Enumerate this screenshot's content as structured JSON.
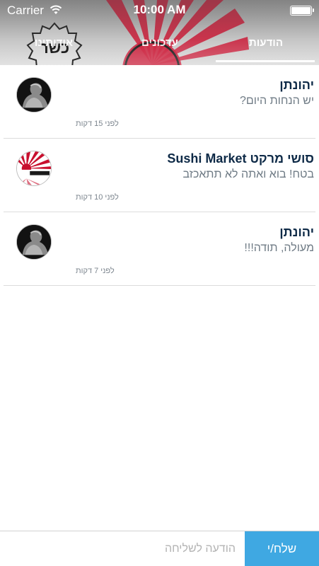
{
  "status_bar": {
    "carrier": "Carrier",
    "time": "10:00 AM"
  },
  "tabs": [
    {
      "label": "הודעות",
      "active": true
    },
    {
      "label": "עדכונים",
      "active": false
    },
    {
      "label": "אודותינו",
      "active": false
    }
  ],
  "header": {
    "badge_text": "כשר",
    "accent_color": "#c8102e"
  },
  "messages": [
    {
      "sender": "יהונתן",
      "preview": "יש הנחות היום?",
      "time": "לפני 15 דקות",
      "avatar": "person-avatar"
    },
    {
      "sender": "סושי מרקט Sushi Market",
      "preview": "בטח! בוא ואתה לא תתאכזב",
      "time": "לפני 10 דקות",
      "avatar": "sushi-market-logo"
    },
    {
      "sender": "יהונתן",
      "preview": "מעולה, תודה!!!",
      "time": "לפני 7 דקות",
      "avatar": "person-avatar"
    }
  ],
  "composer": {
    "placeholder": "הודעה לשליחה",
    "send_label": "שלח/י",
    "send_color": "#3fa8e2"
  }
}
